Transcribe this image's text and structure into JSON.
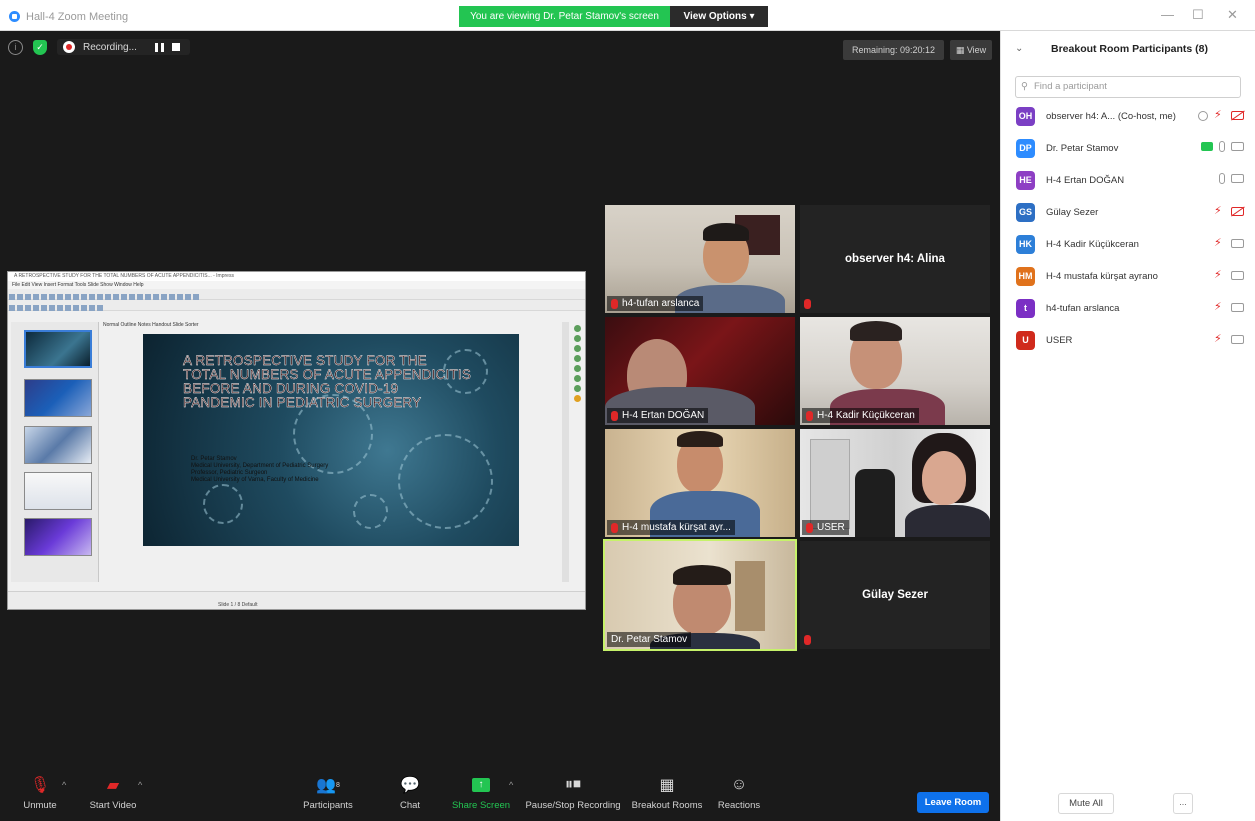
{
  "window": {
    "title": "Hall-4  Zoom Meeting",
    "viewing_banner": "You are viewing Dr. Petar Stamov's screen",
    "view_options": "View Options ▾",
    "controls": [
      "—",
      "☐",
      "✕"
    ]
  },
  "meeting": {
    "recording_label": "Recording...",
    "remaining": "Remaining: 09:20:12",
    "view_label": "View"
  },
  "shared_screen": {
    "app_title": "A RETROSPECTIVE STUDY FOR THE TOTAL NUMBERS OF ACUTE APPENDICITIS... - Impress",
    "menu": "File  Edit  View  Insert  Format  Tools  Slide Show  Window  Help",
    "tabs": "Normal  Outline  Notes  Handout  Slide Sorter",
    "slide_title": "A RETROSPECTIVE STUDY FOR THE TOTAL NUMBERS OF ACUTE APPENDICITIS BEFORE AND DURING COVID-19 PANDEMIC IN PEDIATRIC SURGERY",
    "slide_authors": "Dr. Petar Stamov\nMedical University, Department of Pediatric Surgery\nProfessor, Pediatric Surgeon\nMedical University of Varna, Faculty of Medicine",
    "status": "Slide 1 / 8    Default"
  },
  "tiles": [
    {
      "name": "h4-tufan arslanca",
      "video": true
    },
    {
      "name": "observer h4: Alina",
      "video": false
    },
    {
      "name": "H-4 Ertan DOĞAN",
      "video": true
    },
    {
      "name": "H-4 Kadir Küçükceran",
      "video": true
    },
    {
      "name": "H-4 mustafa kürşat ayr...",
      "video": true
    },
    {
      "name": "USER",
      "video": true
    },
    {
      "name": "Dr. Petar Stamov",
      "video": true
    },
    {
      "name": "Gülay Sezer",
      "video": false
    }
  ],
  "toolbar": {
    "unmute": "Unmute",
    "start_video": "Start Video",
    "participants": "Participants",
    "participants_count": "8",
    "chat": "Chat",
    "share_screen": "Share Screen",
    "pause_stop_recording": "Pause/Stop Recording",
    "breakout_rooms": "Breakout Rooms",
    "reactions": "Reactions",
    "leave_room": "Leave Room"
  },
  "panel": {
    "title": "Breakout Room Participants (8)",
    "find_placeholder": "Find a participant",
    "mute_all": "Mute All",
    "more": "...",
    "participants": [
      {
        "initials": "OH",
        "color": "#7b3fc4",
        "name": "observer h4: A...  (Co-host, me)"
      },
      {
        "initials": "DP",
        "color": "#2d8cff",
        "name": "Dr. Petar Stamov"
      },
      {
        "initials": "HE",
        "color": "#8e3fc4",
        "name": "H-4 Ertan DOĞAN"
      },
      {
        "initials": "GS",
        "color": "#2d6fc4",
        "name": "Gülay Sezer"
      },
      {
        "initials": "HK",
        "color": "#2d7fd8",
        "name": "H-4 Kadir Küçükceran"
      },
      {
        "initials": "HM",
        "color": "#e0721c",
        "name": "H-4 mustafa kürşat ayrano"
      },
      {
        "initials": "t",
        "color": "#7b2fc4",
        "name": "h4-tufan arslanca"
      },
      {
        "initials": "U",
        "color": "#d02a1c",
        "name": "USER"
      }
    ]
  },
  "colors": {
    "accent": "#2d8cff",
    "green": "#23c552",
    "leave": "#0e71eb",
    "muted": "#e02828"
  }
}
